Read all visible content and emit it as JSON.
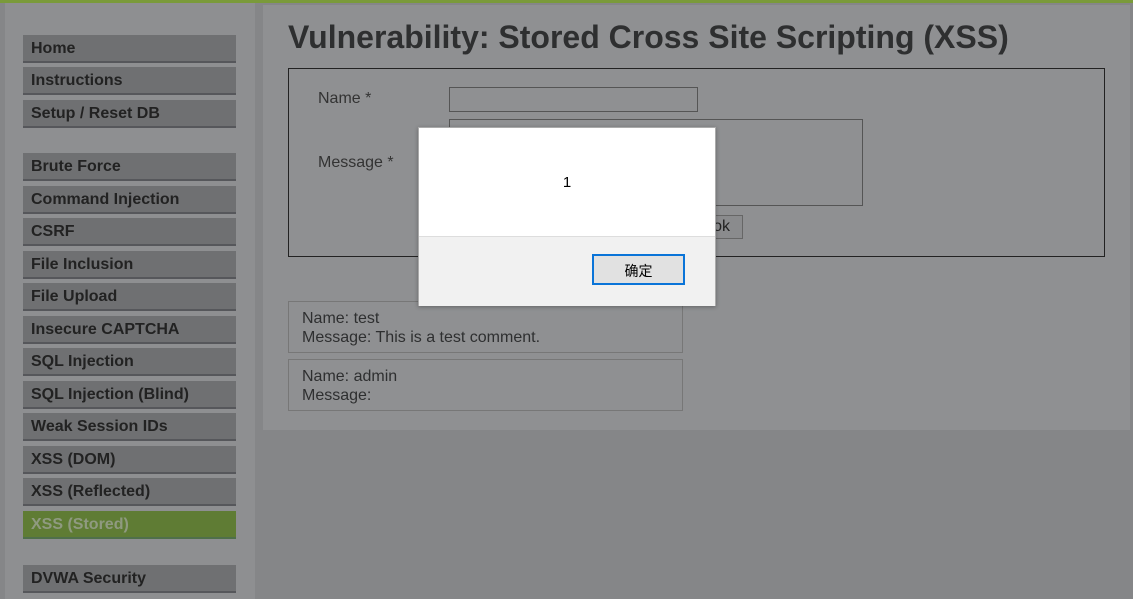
{
  "colors": {
    "accent": "#7a9a3a",
    "active_item": "#5f7c34",
    "dialog_button_border": "#0a74d8"
  },
  "sidebar": {
    "groups": [
      [
        "Home",
        "Instructions",
        "Setup / Reset DB"
      ],
      [
        "Brute Force",
        "Command Injection",
        "CSRF",
        "File Inclusion",
        "File Upload",
        "Insecure CAPTCHA",
        "SQL Injection",
        "SQL Injection (Blind)",
        "Weak Session IDs",
        "XSS (DOM)",
        "XSS (Reflected)",
        "XSS (Stored)"
      ],
      [
        "DVWA Security"
      ]
    ],
    "active": "XSS (Stored)"
  },
  "main": {
    "title": "Vulnerability: Stored Cross Site Scripting (XSS)",
    "form": {
      "name_label": "Name *",
      "message_label": "Message *",
      "name_value": "",
      "message_value": "",
      "submit_label": "Sign Guestbook"
    },
    "comments": [
      {
        "name": "Name: test",
        "message": "Message: This is a test comment."
      },
      {
        "name": "Name: admin",
        "message": "Message:"
      }
    ]
  },
  "dialog": {
    "message": "1",
    "ok_label": "确定"
  }
}
